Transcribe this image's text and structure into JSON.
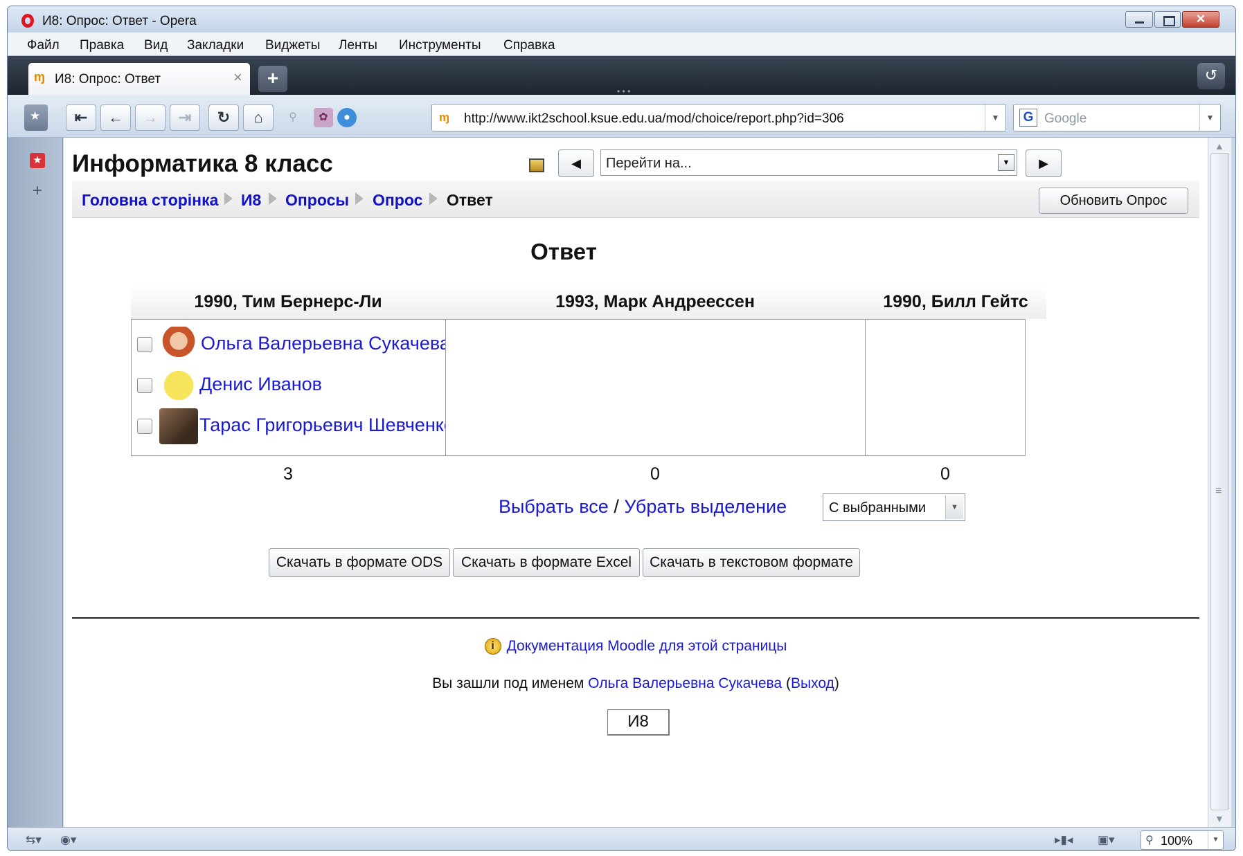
{
  "window": {
    "title": "И8: Опрос: Ответ - Opera"
  },
  "menu": [
    "Файл",
    "Правка",
    "Вид",
    "Закладки",
    "Виджеты",
    "Ленты",
    "Инструменты",
    "Справка"
  ],
  "tabs": [
    {
      "title": "И8: Опрос: Ответ",
      "active": true
    }
  ],
  "address_bar": {
    "url": "http://www.ikt2school.ksue.edu.ua/mod/choice/report.php?id=306"
  },
  "search_bar": {
    "placeholder": "Google"
  },
  "page": {
    "course_title": "Информатика 8 класс",
    "jump_select": "Перейти на...",
    "breadcrumb": [
      "Головна сторінка",
      "И8",
      "Опросы",
      "Опрос",
      "Ответ"
    ],
    "update_button": "Обновить Опрос",
    "heading": "Ответ",
    "columns": [
      {
        "header": "1990, Тим Бернерс-Ли",
        "users": [
          "Ольга Валерьевна Сукачева",
          "Денис Иванов",
          "Тарас Григорьевич Шевченко"
        ],
        "count": "3"
      },
      {
        "header": "1993, Марк Андреессен",
        "users": [],
        "count": "0"
      },
      {
        "header": "1990, Билл Гейтс",
        "users": [],
        "count": "0"
      }
    ],
    "select_all": "Выбрать все",
    "select_sep": "/",
    "deselect_all": "Убрать выделение",
    "with_selected": "С выбранными",
    "download_buttons": [
      "Скачать в формате ODS",
      "Скачать в формате Excel",
      "Скачать в текстовом формате"
    ],
    "doc_link": "Документация Moodle для этой страницы",
    "login_prefix": "Вы зашли под именем",
    "login_user": "Ольга Валерьевна Сукачева",
    "logout_open": "(",
    "logout": "Выход",
    "logout_close": ")",
    "home_button": "И8"
  },
  "status_bar": {
    "zoom": "100%"
  },
  "colors": {
    "link": "#1a1ad4",
    "close_button": "#c2402f",
    "opera_logo": "#e0141e"
  }
}
